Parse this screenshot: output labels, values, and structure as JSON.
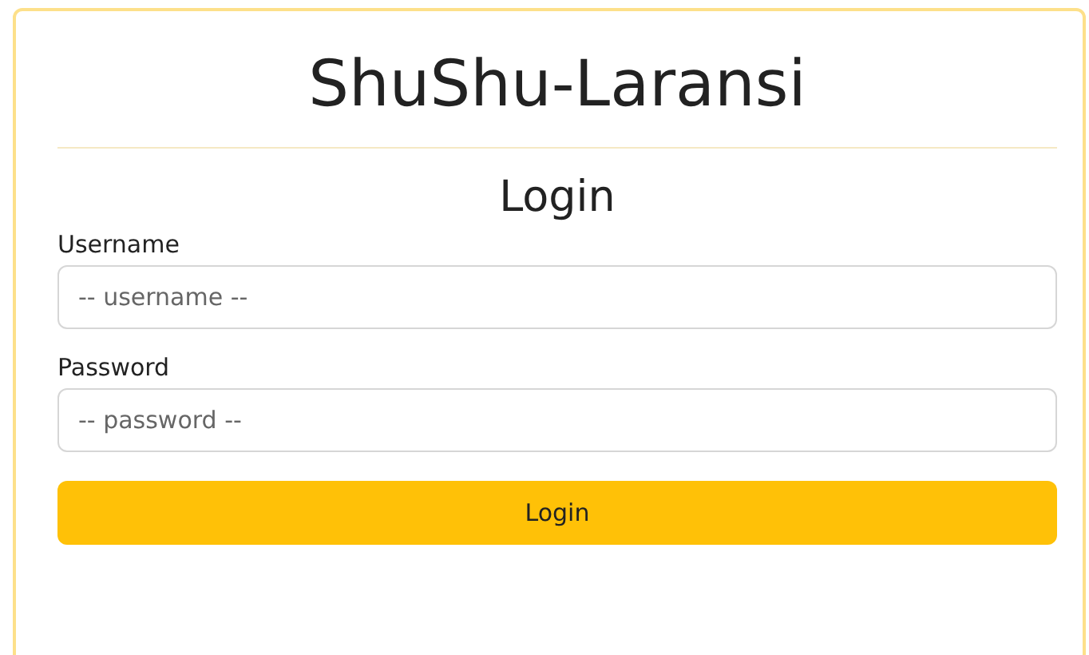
{
  "app_title": "ShuShu-Laransi",
  "form": {
    "heading": "Login",
    "fields": [
      {
        "label": "Username",
        "placeholder": "-- username --"
      },
      {
        "label": "Password",
        "placeholder": "-- password --"
      }
    ],
    "submit": "Login"
  }
}
